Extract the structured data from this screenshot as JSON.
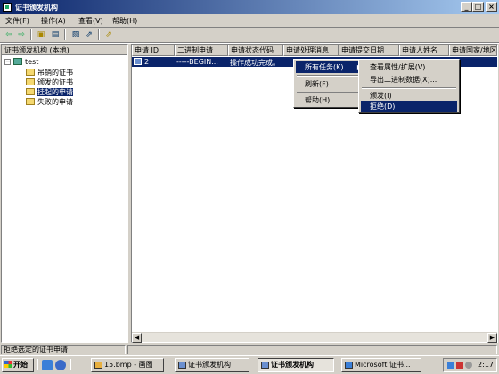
{
  "window": {
    "title": "证书颁发机构",
    "controls": {
      "minimize": "_",
      "maximize": "□",
      "close": "×"
    }
  },
  "menu": {
    "items": [
      "文件(F)",
      "操作(A)",
      "查看(V)",
      "帮助(H)"
    ]
  },
  "toolbar": {
    "back": "⇦",
    "forward": "⇨",
    "up": "▣",
    "details": "▤",
    "props": "▧",
    "export": "⇗"
  },
  "tree": {
    "header": "证书颁发机构 (本地)",
    "root": "test",
    "items": [
      "吊销的证书",
      "颁发的证书",
      "挂起的申请",
      "失败的申请"
    ],
    "selected_index": 2
  },
  "list": {
    "columns": [
      "申请 ID",
      "二进制申请",
      "申请状态代码",
      "申请处理消息",
      "申请提交日期",
      "申请人姓名",
      "申请国家/地区"
    ],
    "rows": [
      {
        "id": "2",
        "binary": "-----BEGIN...",
        "status": "操作成功完成。",
        "msg": "",
        "date": "",
        "name": "",
        "country": ""
      }
    ]
  },
  "context_menu": {
    "items": [
      {
        "label": "所有任务(K)",
        "submenu": true,
        "highlighted": true
      },
      {
        "label": "刷新(F)"
      },
      {
        "label": "帮助(H)"
      }
    ],
    "arrow": "▶"
  },
  "submenu": {
    "items": [
      {
        "label": "查看属性/扩展(V)..."
      },
      {
        "label": "导出二进制数据(X)..."
      },
      {
        "label": "颁发(I)"
      },
      {
        "label": "拒绝(D)",
        "highlighted": true
      }
    ]
  },
  "statusbar": {
    "text": "拒绝选定的证书申请"
  },
  "taskbar": {
    "start": "开始",
    "tasks": [
      {
        "label": "15.bmp - 画图"
      },
      {
        "label": "证书颁发机构"
      },
      {
        "label": "证书颁发机构",
        "active": true
      },
      {
        "label": "Microsoft 证书..."
      }
    ],
    "clock": "2:17"
  },
  "scroll": {
    "left": "◀",
    "right": "▶"
  },
  "colors": {
    "selection": "#0a246a",
    "face": "#d4d0c8",
    "title_start": "#0a246a",
    "title_end": "#a6caf0"
  }
}
